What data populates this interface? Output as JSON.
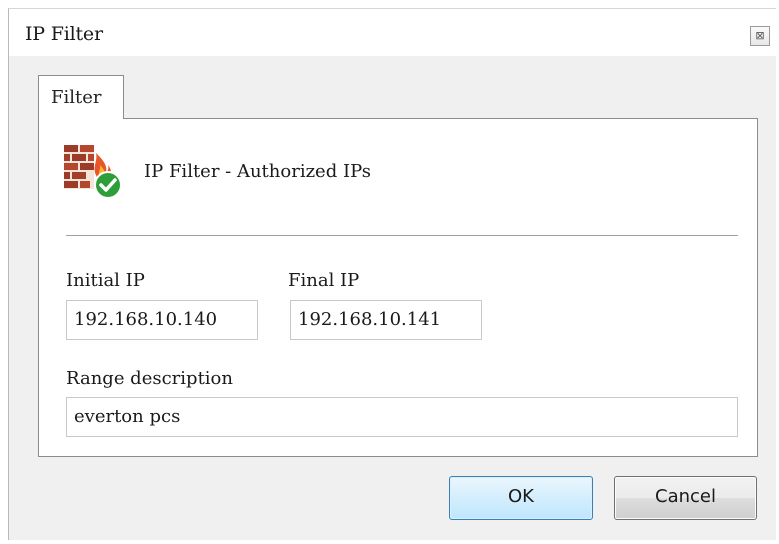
{
  "window": {
    "title": "IP Filter",
    "close_glyph": "⊠"
  },
  "tabs": [
    {
      "label": "Filter",
      "active": true
    }
  ],
  "header": {
    "icon": "firewall-check-icon",
    "text": "IP Filter - Authorized IPs"
  },
  "form": {
    "initial_ip_label": "Initial IP",
    "initial_ip_value": "192.168.10.140",
    "final_ip_label": "Final IP",
    "final_ip_value": "192.168.10.141",
    "range_description_label": "Range description",
    "range_description_value": "everton pcs"
  },
  "buttons": {
    "ok_label": "OK",
    "cancel_label": "Cancel"
  },
  "colors": {
    "ok_border": "#3c7fb1",
    "ok_fill": "#bee6fd",
    "brick": "#9c3b2a",
    "check_green": "#2e9e3a"
  }
}
